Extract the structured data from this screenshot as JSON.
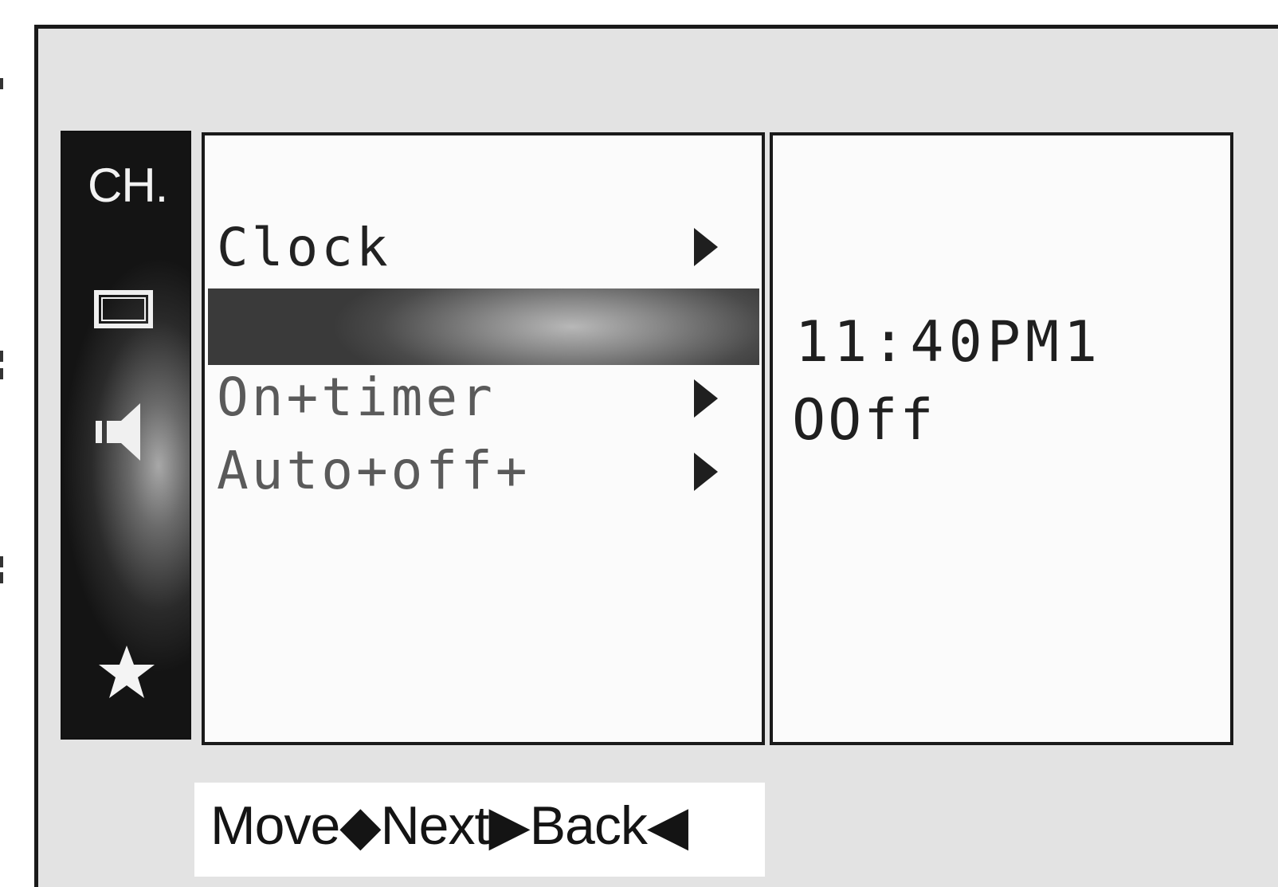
{
  "sidebar": {
    "channel_label": "CH.",
    "icons": [
      "screen-icon",
      "speaker-icon",
      "star-icon"
    ]
  },
  "menu": {
    "items": [
      {
        "label": "Clock",
        "arrow": "right-arrow-icon"
      },
      {
        "label": "",
        "selected": true
      },
      {
        "label": "On+timer",
        "arrow": "right-arrow-icon"
      },
      {
        "label": "Auto+off+",
        "arrow": "right-arrow-icon"
      }
    ]
  },
  "values": {
    "time": "11:40PM1",
    "status": "OOff"
  },
  "help": {
    "text": "Move◆Next▶Back◀"
  },
  "colors": {
    "frame_bg": "#e3e3e3",
    "panel_bg": "#fbfbfb",
    "sidebar_dark": "#141414",
    "text": "#1f1f1f"
  }
}
